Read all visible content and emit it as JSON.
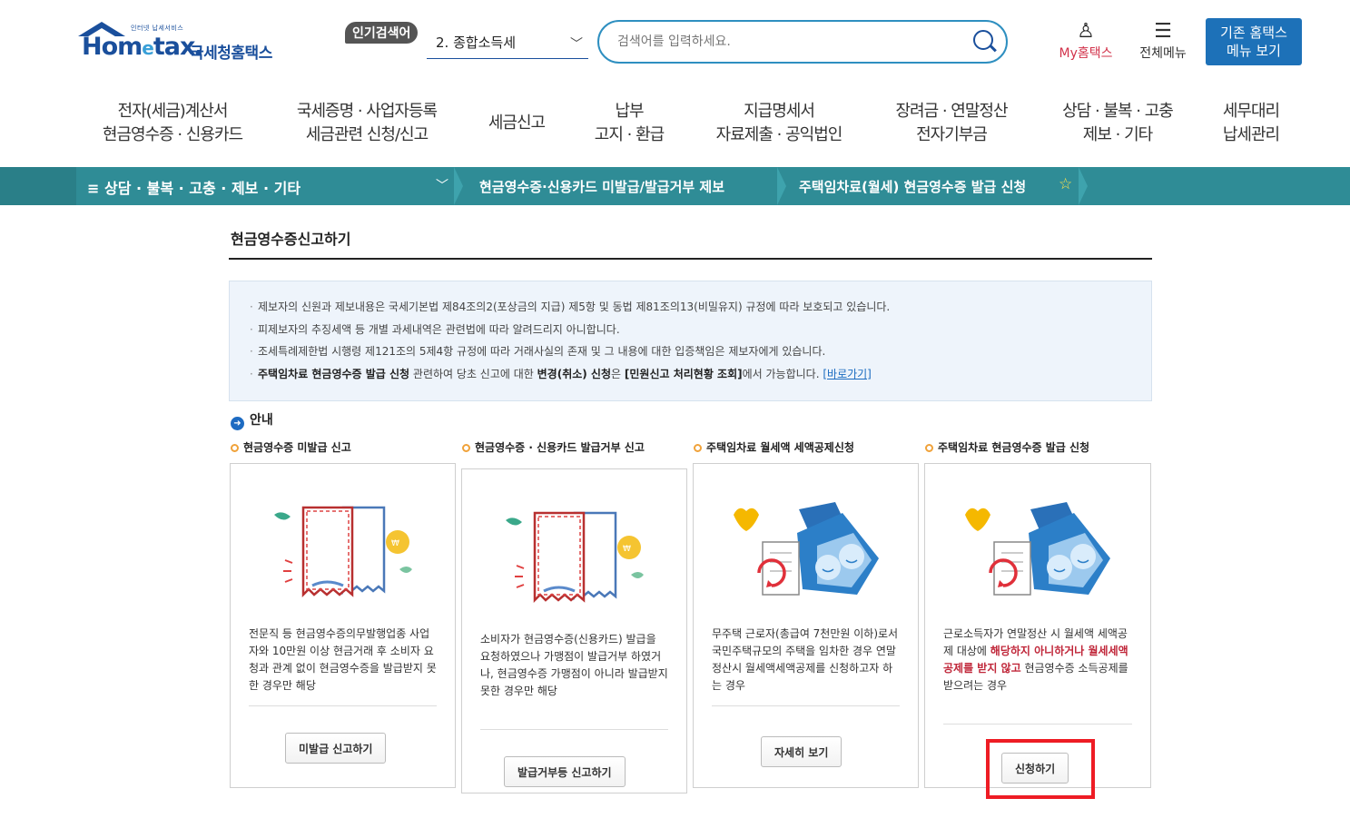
{
  "header": {
    "logo_tagline": "인터넷 납세서비스",
    "logo_brand_main": "Hom",
    "logo_brand_e": "e",
    "logo_brand_tail": "tax.",
    "logo_korean": "국세청홈택스",
    "popular_badge": "인기검색어",
    "popular_selected": "2.  종합소득세",
    "search_placeholder": "검색어를 입력하세요.",
    "my_hometax": "My홈택스",
    "all_menu": "전체메뉴",
    "old_menu_line1": "기존 홈택스",
    "old_menu_line2": "메뉴 보기"
  },
  "gnb": [
    {
      "line1": "전자(세금)계산서",
      "line2": "현금영수증 · 신용카드"
    },
    {
      "line1": "국세증명 · 사업자등록",
      "line2": "세금관련 신청/신고"
    },
    {
      "line1": "세금신고",
      "line2": ""
    },
    {
      "line1": "납부",
      "line2": "고지 · 환급"
    },
    {
      "line1": "지급명세서",
      "line2": "자료제출 · 공익법인"
    },
    {
      "line1": "장려금 · 연말정산",
      "line2": "전자기부금"
    },
    {
      "line1": "상담 · 불복 · 고충",
      "line2": "제보 · 기타"
    },
    {
      "line1": "세무대리",
      "line2": "납세관리"
    }
  ],
  "breadcrumb": {
    "level1": "≡  상담 · 불복 · 고충 · 제보 · 기타",
    "level2": "현금영수증·신용카드 미발급/발급거부 제보",
    "level3": "주택임차료(월세) 현금영수증 발급 신청"
  },
  "page_title": "현금영수증신고하기",
  "notice": {
    "line1": "제보자의 신원과 제보내용은 국세기본법 제84조의2(포상금의 지급) 제5항 및 동법 제81조의13(비밀유지) 규정에 따라 보호되고 있습니다.",
    "line2": "피제보자의 추징세액 등 개별 과세내역은 관련법에 따라 알려드리지 아니합니다.",
    "line3": "조세특례제한법 시행령 제121조의 5제4항 규정에 따라 거래사실의 존재 및 그 내용에 대한 입증책임은 제보자에게 있습니다.",
    "line4_bold1": "주택임차료 현금영수증 발급 신청",
    "line4_text1": " 관련하여 당초 신고에 대한 ",
    "line4_bold2": "변경(취소) 신청",
    "line4_text2": "은 ",
    "line4_bold3": "[민원신고 처리현황 조회]",
    "line4_text3": "에서 가능합니다. ",
    "line4_link": "[바로가기]"
  },
  "guide_label": "안내",
  "cards": [
    {
      "title": "현금영수증 미발급 신고",
      "desc": "전문직 등 현금영수증의무발행업종 사업자와 10만원 이상 현금거래 후 소비자 요청과 관계 없이 현금영수증을 발급받지 못한 경우만 해당",
      "button": "미발급 신고하기"
    },
    {
      "title": "현금영수증 · 신용카드 발급거부 신고",
      "desc": "소비자가 현금영수증(신용카드) 발급을 요청하였으나 가맹점이 발급거부 하였거나, 현금영수증 가맹점이 아니라 발급받지 못한 경우만 해당",
      "button": "발급거부등 신고하기"
    },
    {
      "title": "주택임차료 월세액 세액공제신청",
      "desc": "무주택 근로자(총급여 7천만원 이하)로서 국민주택규모의 주택을 임차한 경우 연말정산시 월세액세액공제를 신청하고자 하는 경우",
      "button": "자세히 보기"
    },
    {
      "title": "주택임차료 현금영수증 발급 신청",
      "desc_pre": "근로소득자가 연말정산 시 월세액 세액공제 대상에 ",
      "desc_red": "해당하지 아니하거나 월세세액공제를 받지 않고",
      "desc_post": " 현금영수증 소득공제를 받으려는 경우",
      "button": "신청하기"
    }
  ],
  "colors": {
    "brand_blue": "#1a4f9c",
    "breadcrumb_teal": "#2f8c96",
    "highlight_red": "#ee1c24",
    "accent_orange": "#f0a23a"
  }
}
